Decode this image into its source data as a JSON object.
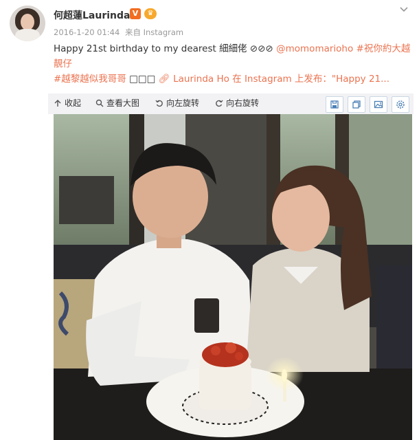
{
  "post": {
    "user": {
      "name": "何超蓮Laurinda",
      "verified_badge": "V",
      "avatar_icon": "profile-avatar"
    },
    "meta": {
      "timestamp": "2016-1-20 01:44",
      "source": "来自 Instagram"
    },
    "text": {
      "line1_main": "Happy 21st birthday to my dearest 細細佬",
      "emoji_glyphs": "⊘⊘⊘",
      "mention": "@momomarioho",
      "hashtag1": "#祝你約大越靚仔",
      "hashtag2": "#越黎越似我哥哥",
      "boxes": "□□□",
      "source_link": "Laurinda Ho 在 Instagram 上发布：\"Happy 21...",
      "link_icon": "link-clip-icon"
    }
  },
  "toolbar": {
    "collapse": "收起",
    "view_large": "查看大图",
    "rotate_left": "向左旋转",
    "rotate_right": "向右旋转",
    "icons": [
      "save-icon",
      "copy-icon",
      "image-icon",
      "settings-icon"
    ]
  },
  "colors": {
    "accent": "#eb7350",
    "meta": "#999999",
    "toolbar_bg": "#f2f2f5",
    "verified": "#f26d21"
  }
}
